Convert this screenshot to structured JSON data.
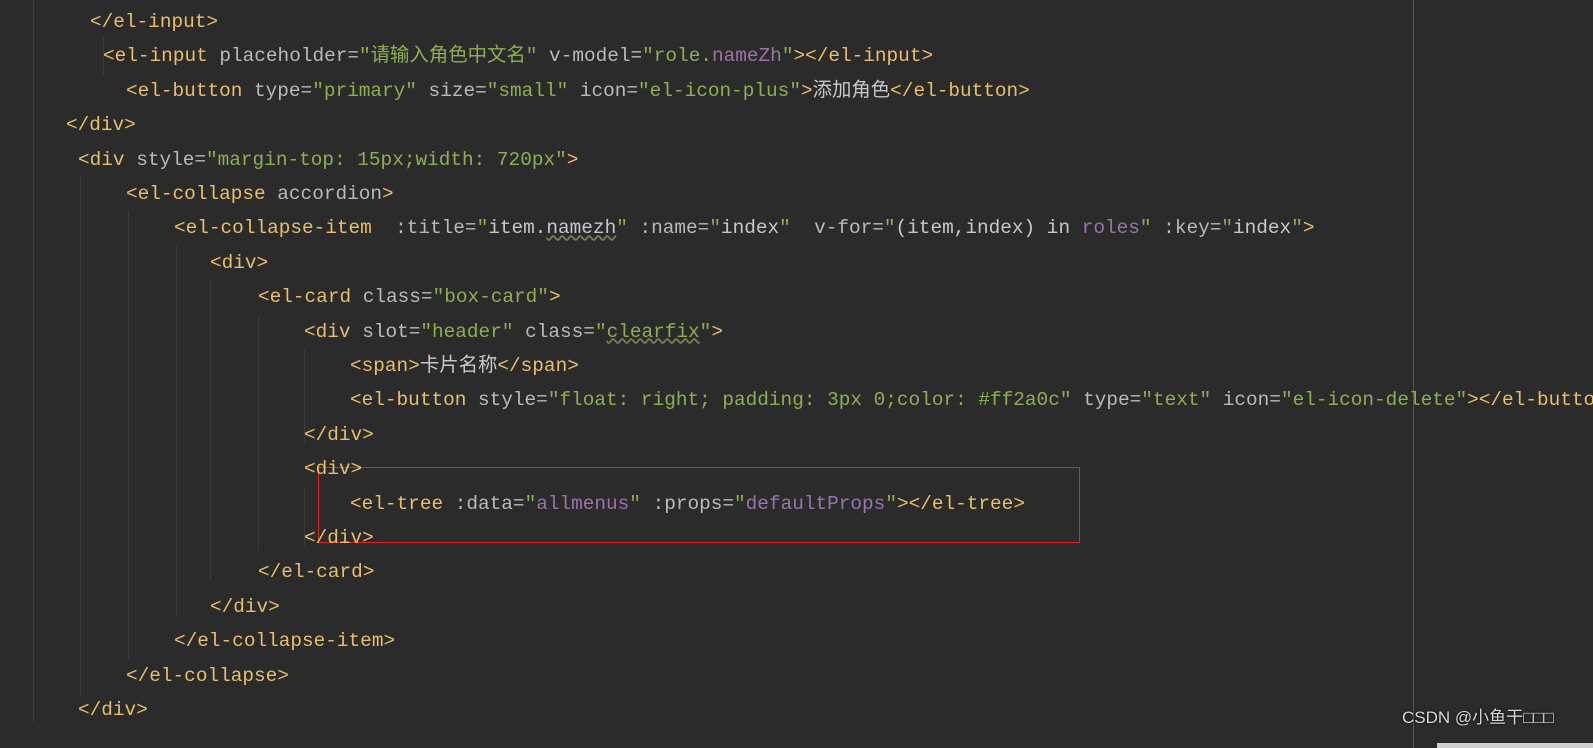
{
  "colors": {
    "background": "#2b2b2b",
    "tag": "#e8bf6a",
    "attribute": "#bababa",
    "string": "#8fae52",
    "vue_expression": "#9876aa",
    "highlight_box": "#e0242a"
  },
  "lines": [
    {
      "tokens": [
        [
          "tag",
          "</el-input>"
        ]
      ]
    },
    {
      "tokens": [
        [
          "tag",
          "<el-input "
        ],
        [
          "attr",
          "placeholder="
        ],
        [
          "str",
          "\"请输入角色中文名\""
        ],
        [
          "attr",
          " v-model="
        ],
        [
          "str",
          "\"role."
        ],
        [
          "vue",
          "nameZh"
        ],
        [
          "str",
          "\""
        ],
        [
          "tag",
          "></el-input>"
        ]
      ]
    },
    {
      "tokens": [
        [
          "tag",
          "<el-button "
        ],
        [
          "attr",
          "type="
        ],
        [
          "str",
          "\"primary\""
        ],
        [
          "attr",
          " size="
        ],
        [
          "str",
          "\"small\""
        ],
        [
          "attr",
          " icon="
        ],
        [
          "str",
          "\"el-icon-plus\""
        ],
        [
          "tag",
          ">"
        ],
        [
          "txt",
          "添加角色"
        ],
        [
          "tag",
          "</el-button>"
        ]
      ]
    },
    {
      "tokens": [
        [
          "tag",
          "</div>"
        ]
      ]
    },
    {
      "tokens": [
        [
          "tag",
          "<div "
        ],
        [
          "attr",
          "style="
        ],
        [
          "str",
          "\"margin-top: 15px;width: 720px\""
        ],
        [
          "tag",
          ">"
        ]
      ]
    },
    {
      "tokens": [
        [
          "tag",
          "<el-collapse "
        ],
        [
          "attr",
          "accordion"
        ],
        [
          "tag",
          ">"
        ]
      ]
    },
    {
      "tokens": [
        [
          "tag",
          "<el-collapse-item  "
        ],
        [
          "attr",
          ":title="
        ],
        [
          "str",
          "\""
        ],
        [
          "txt",
          "item."
        ],
        [
          "txt und",
          "namezh"
        ],
        [
          "str",
          "\""
        ],
        [
          "attr",
          " :name="
        ],
        [
          "str",
          "\""
        ],
        [
          "txt",
          "index"
        ],
        [
          "str",
          "\""
        ],
        [
          "attr",
          "  v-for="
        ],
        [
          "str",
          "\""
        ],
        [
          "txt",
          "(item,index) in "
        ],
        [
          "vue",
          "roles"
        ],
        [
          "str",
          "\""
        ],
        [
          "attr",
          " :key="
        ],
        [
          "str",
          "\""
        ],
        [
          "txt",
          "index"
        ],
        [
          "str",
          "\""
        ],
        [
          "tag",
          ">"
        ]
      ]
    },
    {
      "tokens": [
        [
          "tag",
          "<div>"
        ]
      ]
    },
    {
      "tokens": [
        [
          "tag",
          "<el-card "
        ],
        [
          "attr",
          "class="
        ],
        [
          "str",
          "\"box-card\""
        ],
        [
          "tag",
          ">"
        ]
      ]
    },
    {
      "tokens": [
        [
          "tag",
          "<div "
        ],
        [
          "attr",
          "slot="
        ],
        [
          "str",
          "\"header\""
        ],
        [
          "attr",
          " class="
        ],
        [
          "str",
          "\""
        ],
        [
          "str und",
          "clearfix"
        ],
        [
          "str",
          "\""
        ],
        [
          "tag",
          ">"
        ]
      ]
    },
    {
      "tokens": [
        [
          "tag",
          "<span>"
        ],
        [
          "txt",
          "卡片名称"
        ],
        [
          "tag",
          "</span>"
        ]
      ]
    },
    {
      "tokens": [
        [
          "tag",
          "<el-button "
        ],
        [
          "attr",
          "style="
        ],
        [
          "str",
          "\"float: right; padding: 3px 0;color: #ff2a0c\""
        ],
        [
          "attr",
          " type="
        ],
        [
          "str",
          "\"text\""
        ],
        [
          "attr",
          " icon="
        ],
        [
          "str",
          "\"el-icon-delete\""
        ],
        [
          "tag",
          "></el-button>"
        ]
      ]
    },
    {
      "tokens": [
        [
          "tag",
          "</div>"
        ]
      ]
    },
    {
      "tokens": [
        [
          "tag",
          "<div>"
        ]
      ]
    },
    {
      "tokens": [
        [
          "tag",
          "<el-tree "
        ],
        [
          "attr",
          ":data="
        ],
        [
          "str",
          "\""
        ],
        [
          "vue",
          "allmenus"
        ],
        [
          "str",
          "\""
        ],
        [
          "attr",
          " :props="
        ],
        [
          "str",
          "\""
        ],
        [
          "vue",
          "defaultProps"
        ],
        [
          "str",
          "\""
        ],
        [
          "tag",
          "></el-tree>"
        ]
      ]
    },
    {
      "tokens": [
        [
          "tag",
          "</div>"
        ]
      ]
    },
    {
      "tokens": [
        [
          "tag",
          "</el-card>"
        ]
      ]
    },
    {
      "tokens": [
        [
          "tag",
          "</div>"
        ]
      ]
    },
    {
      "tokens": [
        [
          "tag",
          "</el-collapse-item>"
        ]
      ]
    },
    {
      "tokens": [
        [
          "tag",
          "</el-collapse>"
        ]
      ]
    },
    {
      "tokens": [
        [
          "tag",
          "</div>"
        ]
      ]
    }
  ],
  "watermark": "CSDN @小鱼干□□□"
}
